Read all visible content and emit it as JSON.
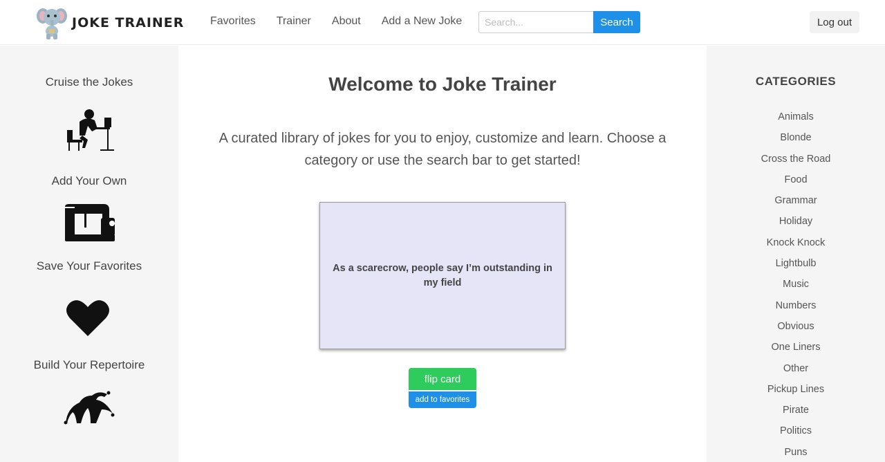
{
  "header": {
    "brand": "JOKE TRAINER",
    "nav": [
      "Favorites",
      "Trainer",
      "About",
      "Add a New Joke"
    ],
    "search": {
      "placeholder": "Search...",
      "button": "Search"
    },
    "logout": "Log out"
  },
  "features": [
    {
      "label": "Cruise the Jokes",
      "icon": "desk-worker-icon"
    },
    {
      "label": "Add Your Own",
      "icon": "sewing-machine-icon"
    },
    {
      "label": "Save Your Favorites",
      "icon": "heart-icon"
    },
    {
      "label": "Build Your Repertoire",
      "icon": "jester-hat-icon"
    }
  ],
  "main": {
    "title": "Welcome to Joke Trainer",
    "intro": "A curated library of jokes for you to enjoy, customize and learn. Choose a category or use the search bar to get started!",
    "card_text": "As a scarecrow, people say I’m outstanding in my field",
    "flip_label": "flip card",
    "favorite_label": "add to favorites"
  },
  "categories": {
    "title": "CATEGORIES",
    "items": [
      "Animals",
      "Blonde",
      "Cross the Road",
      "Food",
      "Grammar",
      "Holiday",
      "Knock Knock",
      "Lightbulb",
      "Music",
      "Numbers",
      "Obvious",
      "One Liners",
      "Other",
      "Pickup Lines",
      "Pirate",
      "Politics",
      "Puns"
    ]
  },
  "colors": {
    "search_button": "#1e90e8",
    "flip_button": "#2ecc5c",
    "card": "#e6e4f7",
    "side_panel": "#f5f5f5"
  }
}
